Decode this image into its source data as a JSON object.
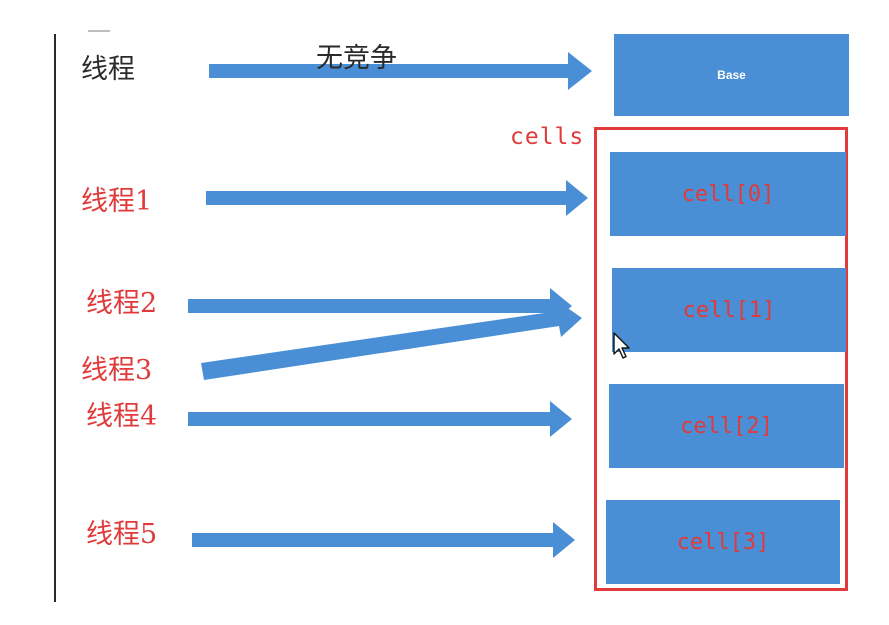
{
  "diagram": {
    "contention_label": "无竞争",
    "base_label": "Base",
    "cells_label": "cells",
    "threads": [
      {
        "id": "main",
        "label": "线程"
      },
      {
        "id": "t1",
        "label": "线程1"
      },
      {
        "id": "t2",
        "label": "线程2"
      },
      {
        "id": "t3",
        "label": "线程3"
      },
      {
        "id": "t4",
        "label": "线程4"
      },
      {
        "id": "t5",
        "label": "线程5"
      }
    ],
    "cells": [
      {
        "label": "cell[0]"
      },
      {
        "label": "cell[1]"
      },
      {
        "label": "cell[2]"
      },
      {
        "label": "cell[3]"
      }
    ],
    "edges": [
      {
        "from": "线程",
        "to": "Base"
      },
      {
        "from": "线程1",
        "to": "cell[0]"
      },
      {
        "from": "线程2",
        "to": "cell[1]"
      },
      {
        "from": "线程3",
        "to": "cell[1]"
      },
      {
        "from": "线程4",
        "to": "cell[2]"
      },
      {
        "from": "线程5",
        "to": "cell[3]"
      }
    ],
    "colors": {
      "arrow": "#4a8fd6",
      "box": "#4a8fd6",
      "accent_red": "#e03a3a",
      "text_black": "#2a2a2a"
    }
  }
}
